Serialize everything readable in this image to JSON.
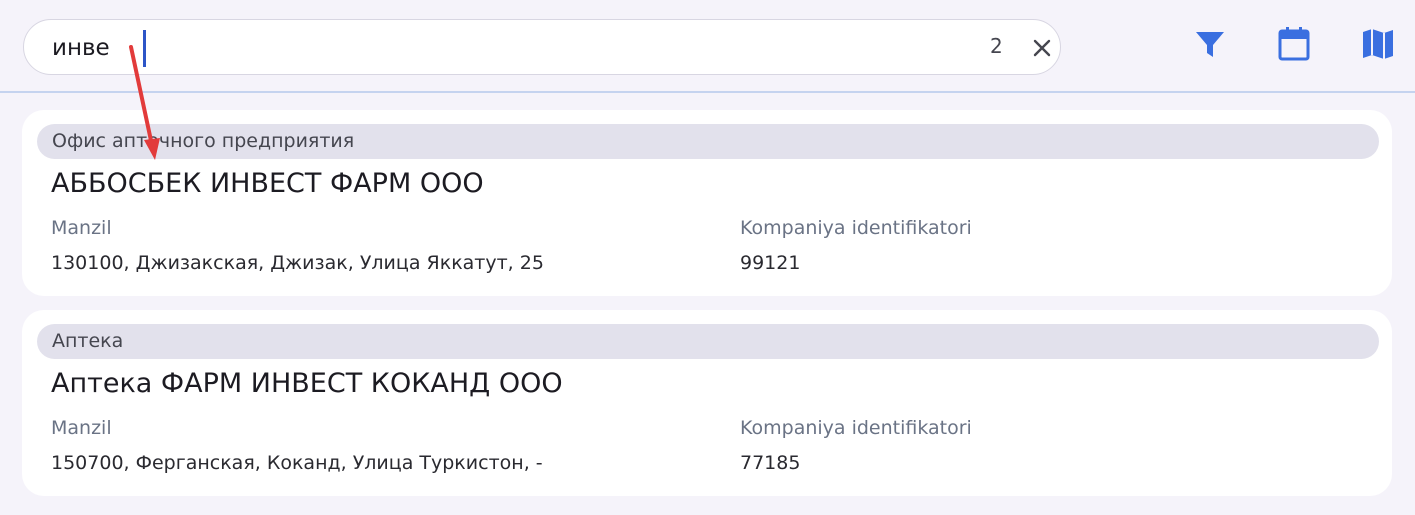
{
  "search": {
    "value": "инве",
    "result_count": "2"
  },
  "toolbar": {
    "icons": [
      "filter-icon",
      "calendar-icon",
      "map-icon"
    ],
    "accent": "#3a6fe0"
  },
  "results": [
    {
      "category": "Офис аптечного предприятия",
      "name": "АББОСБЕК ИНВЕСТ ФАРМ ООО",
      "address_label": "Manzil",
      "address": "130100, Джизакская, Джизак, Улица Яккатут, 25",
      "id_label": "Kompaniya identifikatori",
      "id": "99121"
    },
    {
      "category": "Аптека",
      "name": "Аптека ФАРМ ИНВЕСТ КОКАНД ООО",
      "address_label": "Manzil",
      "address": "150700, Ферганская, Коканд, Улица Туркистон, -",
      "id_label": "Kompaniya identifikatori",
      "id": "77185"
    }
  ]
}
